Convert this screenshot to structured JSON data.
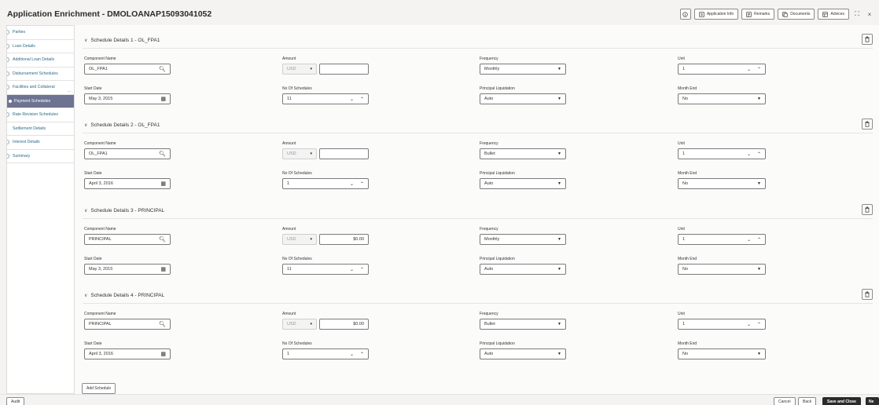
{
  "header": {
    "title": "Application Enrichment - DMOLOANAP15093041052",
    "buttons": {
      "application_info": "Application Info",
      "remarks": "Remarks",
      "documents": "Documents",
      "advices": "Advices"
    }
  },
  "sidebar": {
    "items": [
      {
        "label": "Parties"
      },
      {
        "label": "Loan Details"
      },
      {
        "label": "Additional Loan Details"
      },
      {
        "label": "Disbursement Schedules"
      },
      {
        "label": "Facilities and Collateral"
      },
      {
        "label": "Payment Schedules"
      },
      {
        "label": "Rate Revision Schedules"
      },
      {
        "label": "Settlement Details"
      },
      {
        "label": "Interest Details"
      },
      {
        "label": "Summary"
      }
    ],
    "more": "..."
  },
  "labels": {
    "component_name": "Component Name",
    "amount": "Amount",
    "frequency": "Frequency",
    "unit": "Unit",
    "start_date": "Start Date",
    "no_of_schedules": "No Of Schedules",
    "principal_liquidation": "Principal Liquidation",
    "month_end": "Month End"
  },
  "schedules": [
    {
      "title": "Schedule Details 1 - OL_FPA1",
      "component": "OL_FPA1",
      "currency": "USD",
      "amount": "",
      "frequency": "Monthly",
      "unit": "1",
      "start_date": "May 3, 2015",
      "no_of_schedules": "11",
      "principal_liquidation": "Auto",
      "month_end": "No"
    },
    {
      "title": "Schedule Details 2 - OL_FPA1",
      "component": "OL_FPA1",
      "currency": "USD",
      "amount": "",
      "frequency": "Bullet",
      "unit": "1",
      "start_date": "April 3, 2016",
      "no_of_schedules": "1",
      "principal_liquidation": "Auto",
      "month_end": "No"
    },
    {
      "title": "Schedule Details 3 - PRINCIPAL",
      "component": "PRINCIPAL",
      "currency": "USD",
      "amount": "$0.00",
      "frequency": "Monthly",
      "unit": "1",
      "start_date": "May 3, 2015",
      "no_of_schedules": "11",
      "principal_liquidation": "Auto",
      "month_end": "No"
    },
    {
      "title": "Schedule Details 4 - PRINCIPAL",
      "component": "PRINCIPAL",
      "currency": "USD",
      "amount": "$0.00",
      "frequency": "Bullet",
      "unit": "1",
      "start_date": "April 3, 2016",
      "no_of_schedules": "1",
      "principal_liquidation": "Auto",
      "month_end": "No"
    }
  ],
  "actions": {
    "add_schedule": "Add Schedule",
    "audit": "Audit",
    "cancel": "Cancel",
    "back": "Back",
    "save_and_close": "Save and Close",
    "next": "Ne"
  },
  "icons": {
    "search": "search-icon",
    "calendar": "calendar-icon",
    "delete": "trash-icon",
    "dropdown": "caret-down-icon"
  }
}
